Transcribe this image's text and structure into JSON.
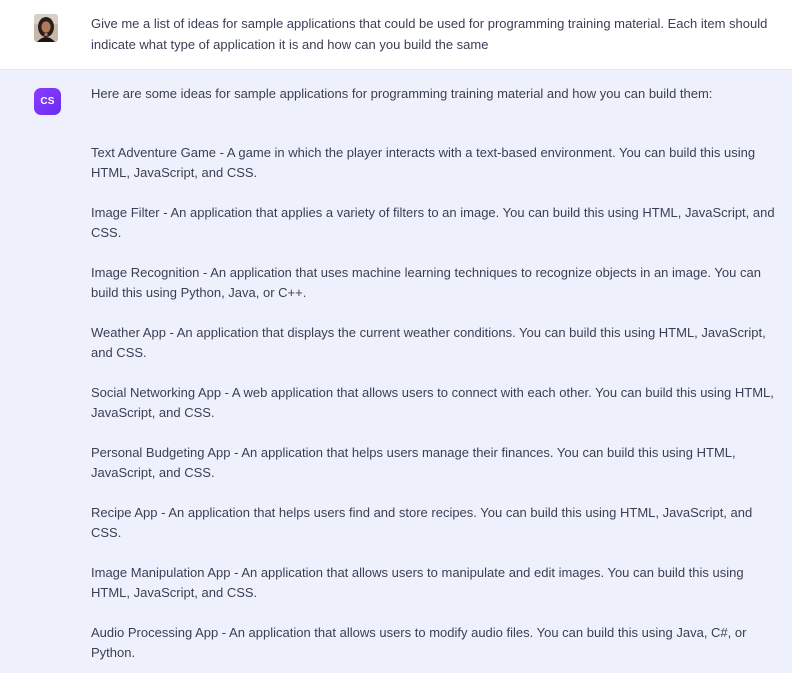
{
  "user_message": {
    "avatar_icon": "user-avatar-photo",
    "text": "Give me a list of ideas for sample applications that could be used for programming training material. Each item should indicate what type of application it is and how can you build the same"
  },
  "assistant_message": {
    "avatar_label": "CS",
    "avatar_color": "#7b35f5",
    "intro": "Here are some ideas for sample applications for programming training material and how you can build them:",
    "items": [
      "Text Adventure Game - A game in which the player interacts with a text-based environment. You can build this using HTML, JavaScript, and CSS.",
      "Image Filter - An application that applies a variety of filters to an image. You can build this using HTML, JavaScript, and CSS.",
      "Image Recognition - An application that uses machine learning techniques to recognize objects in an image. You can build this using Python, Java, or C++.",
      "Weather App - An application that displays the current weather conditions. You can build this using HTML, JavaScript, and CSS.",
      "Social Networking App - A web application that allows users to connect with each other. You can build this using HTML, JavaScript, and CSS.",
      "Personal Budgeting App - An application that helps users manage their finances. You can build this using HTML, JavaScript, and CSS.",
      "Recipe App - An application that helps users find and store recipes. You can build this using HTML, JavaScript, and CSS.",
      "Image Manipulation App - An application that allows users to manipulate and edit images. You can build this using HTML, JavaScript, and CSS.",
      "Audio Processing App - An application that allows users to modify audio files. You can build this using Java, C#, or Python."
    ]
  }
}
